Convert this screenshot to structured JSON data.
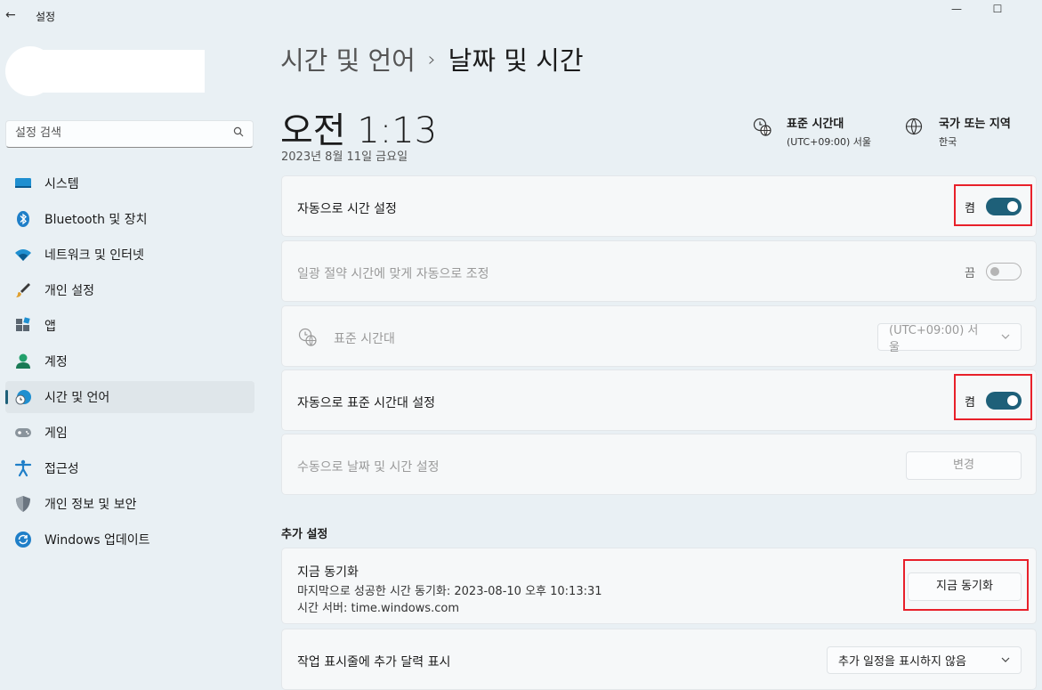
{
  "window": {
    "title": "설정",
    "back_glyph": "←",
    "minimize_glyph": "—",
    "maximize_glyph": "☐"
  },
  "search": {
    "placeholder": "설정 검색"
  },
  "sidebar": {
    "items": [
      {
        "label": "시스템",
        "icon": "system-icon",
        "active": false
      },
      {
        "label": "Bluetooth 및 장치",
        "icon": "bluetooth-icon",
        "active": false
      },
      {
        "label": "네트워크 및 인터넷",
        "icon": "wifi-icon",
        "active": false
      },
      {
        "label": "개인 설정",
        "icon": "brush-icon",
        "active": false
      },
      {
        "label": "앱",
        "icon": "apps-icon",
        "active": false
      },
      {
        "label": "계정",
        "icon": "person-icon",
        "active": false
      },
      {
        "label": "시간 및 언어",
        "icon": "clock-globe-icon",
        "active": true
      },
      {
        "label": "게임",
        "icon": "gamepad-icon",
        "active": false
      },
      {
        "label": "접근성",
        "icon": "accessibility-icon",
        "active": false
      },
      {
        "label": "개인 정보 및 보안",
        "icon": "shield-icon",
        "active": false
      },
      {
        "label": "Windows 업데이트",
        "icon": "update-icon",
        "active": false
      }
    ]
  },
  "header": {
    "breadcrumb_parent": "시간 및 언어",
    "breadcrumb_separator": "›",
    "breadcrumb_current": "날짜 및 시간",
    "time": "오전 1:13",
    "date": "2023년 8월 11일 금요일",
    "timezone_title": "표준 시간대",
    "timezone_value": "(UTC+09:00) 서울",
    "region_title": "국가 또는 지역",
    "region_value": "한국"
  },
  "settings": {
    "auto_time": {
      "label": "자동으로 시간 설정",
      "state": "켬",
      "on": true
    },
    "dst": {
      "label": "일광 절약 시간에 맞게 자동으로 조정",
      "state": "끔",
      "on": false
    },
    "timezone": {
      "label": "표준 시간대",
      "value": "(UTC+09:00) 서울"
    },
    "auto_timezone": {
      "label": "자동으로 표준 시간대 설정",
      "state": "켬",
      "on": true
    },
    "manual": {
      "label": "수동으로 날짜 및 시간 설정",
      "button": "변경"
    }
  },
  "additional": {
    "section_title": "추가 설정",
    "sync_title": "지금 동기화",
    "sync_last": "마지막으로 성공한 시간 동기화: 2023-08-10 오후 10:13:31",
    "sync_server": "시간 서버: time.windows.com",
    "sync_button": "지금 동기화",
    "calendar_label": "작업 표시줄에 추가 달력 표시",
    "calendar_value": "추가 일정을 표시하지 않음"
  },
  "colors": {
    "accent": "#1e6079",
    "highlight": "#e8202a",
    "background": "#e9f0f4"
  }
}
